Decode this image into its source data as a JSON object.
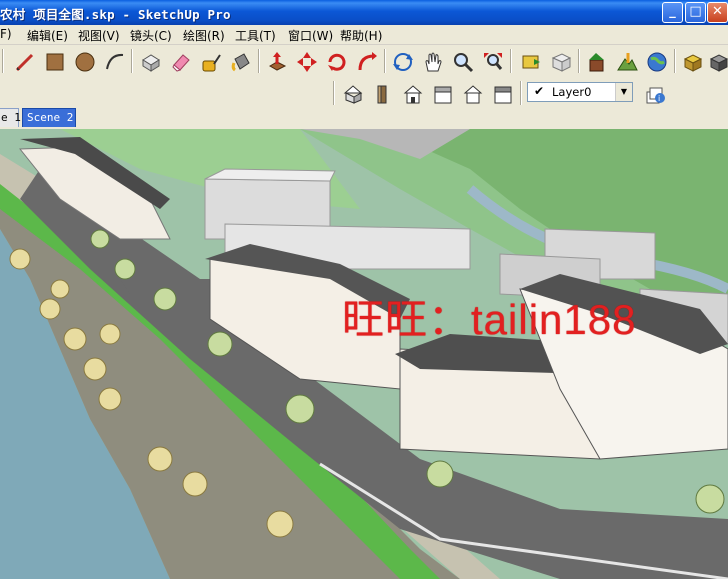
{
  "window": {
    "title": "农村 项目全图.skp - SketchUp Pro"
  },
  "menu": {
    "items": [
      {
        "id": "f",
        "label": "F)"
      },
      {
        "id": "edit",
        "label": "编辑(E)"
      },
      {
        "id": "view",
        "label": "视图(V)"
      },
      {
        "id": "camera",
        "label": "镜头(C)"
      },
      {
        "id": "draw",
        "label": "绘图(R)"
      },
      {
        "id": "tools",
        "label": "工具(T)"
      },
      {
        "id": "window",
        "label": "窗口(W)"
      },
      {
        "id": "help",
        "label": "帮助(H)"
      }
    ]
  },
  "toolbar": {
    "layer_current": "Layer0"
  },
  "scenes": {
    "tabs": [
      {
        "label": "e 1",
        "active": false
      },
      {
        "label": "Scene 2",
        "active": true
      }
    ]
  },
  "viewport": {
    "watermark": "旺旺：tailin188"
  },
  "colors": {
    "titlebar": "#0b57d6",
    "active_tab": "#3a6ed8",
    "watermark": "#e22020",
    "river": "#7fa9b8",
    "lawn": "#5cb84a",
    "road": "#6a6a6a"
  }
}
